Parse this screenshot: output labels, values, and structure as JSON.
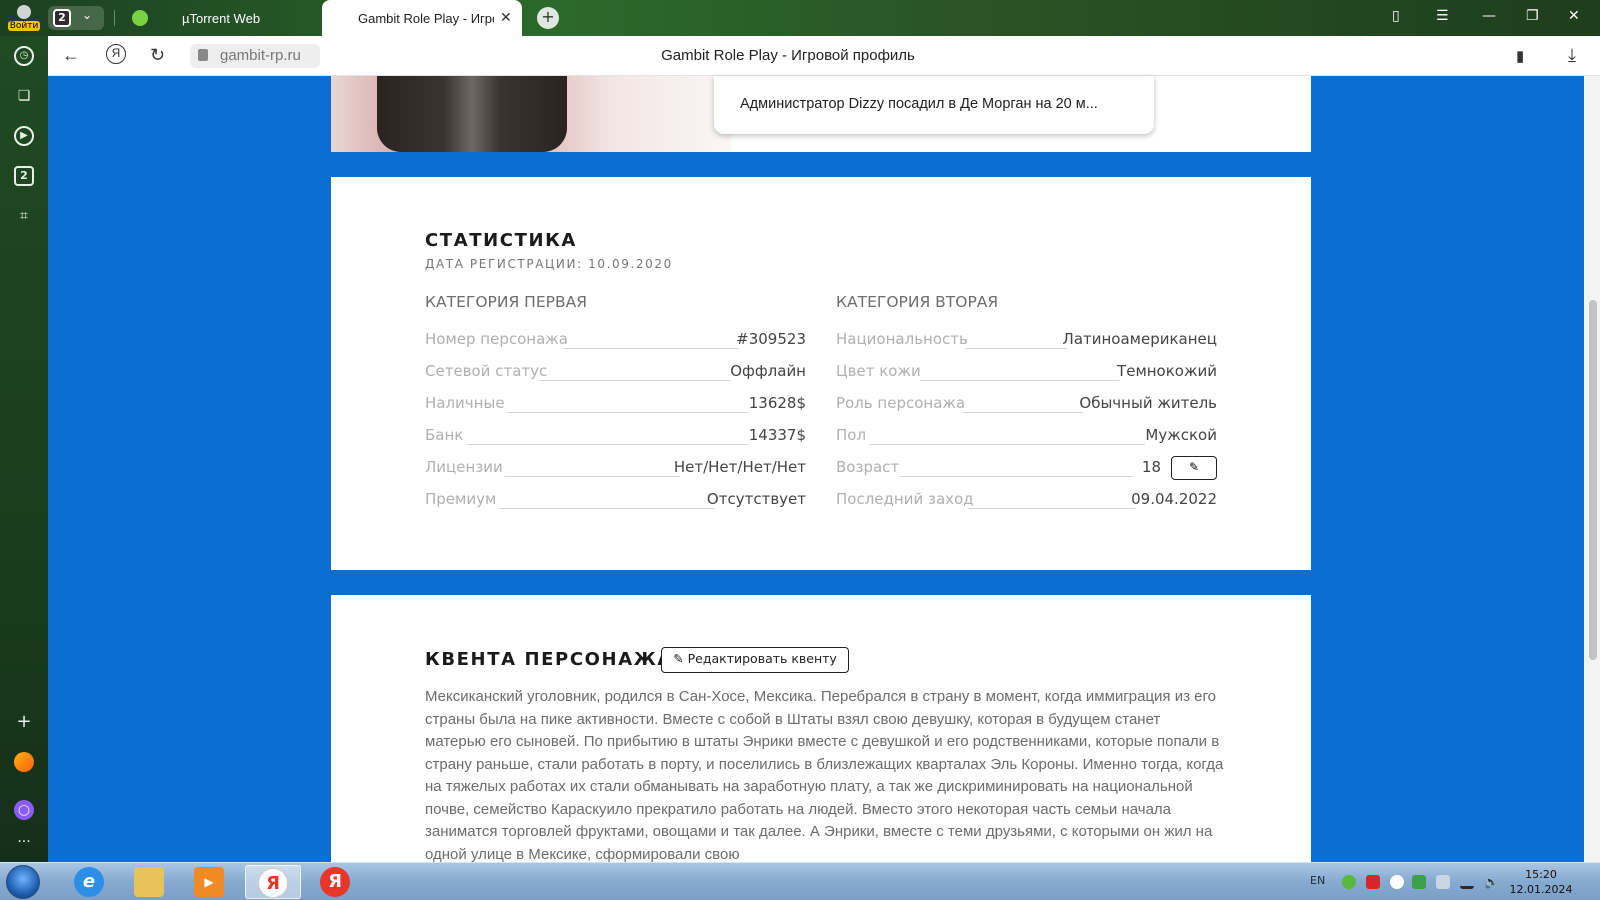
{
  "browser": {
    "login_label": "Войти",
    "tab_count": "2",
    "tabs": [
      {
        "title": "µTorrent Web"
      },
      {
        "title": "Gambit Role Play - Игровой профиль"
      }
    ],
    "new_tab": "+",
    "close_tab": "✕",
    "url": "gambit-rp.ru",
    "page_title": "Gambit Role Play - Игровой профиль",
    "sidebar_badge": "2"
  },
  "notification": {
    "text": "Администратор Dizzy посадил в Де Морган на 20 м..."
  },
  "stats": {
    "title": "СТАТИСТИКА",
    "subtitle": "ДАТА РЕГИСТРАЦИИ: 10.09.2020",
    "cat1": {
      "title": "КАТЕГОРИЯ ПЕРВАЯ",
      "rows": [
        {
          "label": "Номер персонажа",
          "value": "#309523"
        },
        {
          "label": "Сетевой статус",
          "value": "Оффлайн"
        },
        {
          "label": "Наличные",
          "value": "13628$"
        },
        {
          "label": "Банк",
          "value": "14337$"
        },
        {
          "label": "Лицензии",
          "value": "Нет/Нет/Нет/Нет"
        },
        {
          "label": "Премиум",
          "value": "Отсутствует"
        }
      ]
    },
    "cat2": {
      "title": "КАТЕГОРИЯ ВТОРАЯ",
      "rows": [
        {
          "label": "Национальность",
          "value": "Латиноамериканец"
        },
        {
          "label": "Цвет кожи",
          "value": "Темнокожий"
        },
        {
          "label": "Роль персонажа",
          "value": "Обычный житель"
        },
        {
          "label": "Пол",
          "value": "Мужской"
        },
        {
          "label": "Возраст",
          "value": "18"
        },
        {
          "label": "Последний заход",
          "value": "09.04.2022"
        }
      ]
    }
  },
  "bio": {
    "title": "КВЕНТА ПЕРСОНАЖА",
    "edit_label": "Редактировать квенту",
    "text": "Мексиканский уголовник, родился в Сан-Хосе, Мексика. Перебрался в страну в момент, когда иммиграция из его страны была на пике активности. Вместе с собой в Штаты взял свою девушку, которая в будущем станет матерью его сыновей. По прибытию в штаты Энрики вместе с девушкой и его родственниками, которые попали в страну раньше, стали работать в порту, и поселились в близлежащих кварталах Эль Короны. Именно тогда, когда на тяжелых работах их стали обманывать на заработную плату, а так же дискриминировать на национальной почве, семейство Караскуило прекратило работать на людей. Вместо этого некоторая часть семьи начала заниматся торговлей фруктами, овощами и так далее. А Энрики, вместе с теми друзьями, с которыми он жил на одной улице в Мексике, сформировали свою"
  },
  "taskbar": {
    "lang": "EN",
    "time": "15:20",
    "date": "12.01.2024",
    "yandex_glyph": "Я"
  },
  "colors": {
    "page_bg": "#0a6fd1",
    "card_bg": "#ffffff",
    "label": "#b0b0b0",
    "value": "#444444"
  },
  "icons": [
    "back-arrow-icon",
    "yandex-icon",
    "reload-icon",
    "lock-icon",
    "bookmark-icon",
    "download-icon",
    "pencil-icon",
    "history-icon",
    "collections-icon",
    "video-icon",
    "screenshot-icon",
    "plus-icon",
    "alice-icon",
    "more-icon"
  ]
}
